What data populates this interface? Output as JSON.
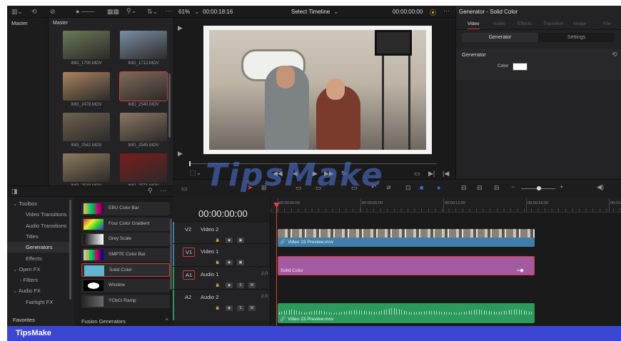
{
  "topbar": {
    "zoom": "61%",
    "timecode": "00:00:18:16",
    "timeline_selector": "Select Timeline",
    "viewer_timecode": "00:00:00:00"
  },
  "media_pool": {
    "bin_root": "Master",
    "breadcrumb": "Master",
    "clips": [
      {
        "name": "IMG_1700.MOV",
        "color": "#6a7a58"
      },
      {
        "name": "IMG_1712.MOV",
        "color": "#7a8fa5"
      },
      {
        "name": "IMG_2478.MOV",
        "color": "#a98360"
      },
      {
        "name": "IMG_2540.MOV",
        "color": "#7f6a5a"
      },
      {
        "name": "IMG_2542.MOV",
        "color": "#6d6350"
      },
      {
        "name": "IMG_2545.MOV",
        "color": "#8a7764"
      },
      {
        "name": "IMG_2549.MOV",
        "color": "#8d7a5e"
      },
      {
        "name": "IMG_2571.MOV",
        "color": "#7a1d1d"
      }
    ]
  },
  "inspector": {
    "title": "Generator - Solid Color",
    "tabs": [
      "Video",
      "Audio",
      "Effects",
      "Transition",
      "Image",
      "File"
    ],
    "subtabs": [
      "Generator",
      "Settings"
    ],
    "section": "Generator",
    "color_label": "Color",
    "color_value": "#ffffff"
  },
  "toolbox": {
    "items": [
      "Toolbox",
      "Video Transitions",
      "Audio Transitions",
      "Titles",
      "Generators",
      "Effects",
      "Open FX",
      "Filters",
      "Audio FX",
      "Fairlight FX"
    ],
    "favorites": "Favorites"
  },
  "generators": {
    "items": [
      "EBU Color Bar",
      "Four Color Gradient",
      "Grey Scale",
      "SMPTE Color Bar",
      "Solid Color",
      "Window",
      "YCbCr Ramp"
    ],
    "footer": "Fusion Generators"
  },
  "timeline": {
    "timecode": "00:00:00:00",
    "ruler": [
      "00:00:00:00",
      "00:00:06:00",
      "00:00:12:00",
      "00:00:18:00",
      "00:00:24"
    ],
    "tracks": [
      {
        "id": "V2",
        "name": "Video 2",
        "level": ""
      },
      {
        "id": "V1",
        "name": "Video 1",
        "level": ""
      },
      {
        "id": "A1",
        "name": "Audio 1",
        "level": "2.0"
      },
      {
        "id": "A2",
        "name": "Audio 2",
        "level": "2.0"
      }
    ],
    "clip_v2": "Video 23 Preview.mov",
    "clip_v1": "Solid Color",
    "clip_a2": "Video 23 Preview.mov"
  },
  "watermark": "TipsMake",
  "brand": "TipsMake",
  "colors": {
    "accent": "#d23a3a",
    "solid_clip": "#a45aa0",
    "video_clip": "#3f7ea8",
    "audio_clip": "#2c9a5c",
    "brand_bar": "#3b47d3"
  }
}
